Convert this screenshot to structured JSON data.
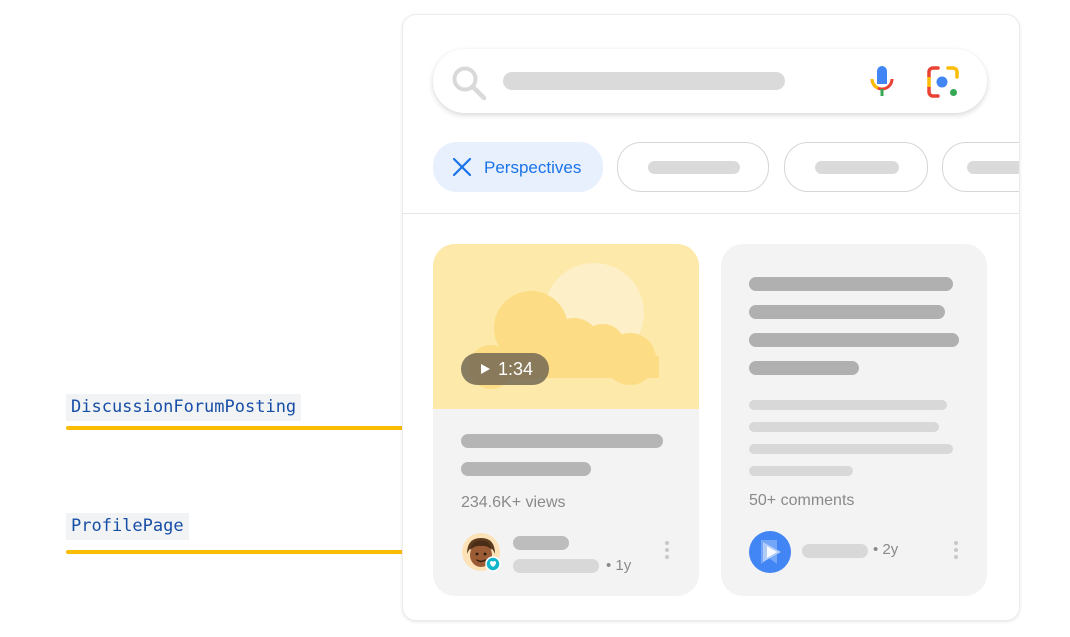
{
  "search": {
    "icon": "search-icon",
    "mic_icon": "mic-icon",
    "lens_icon": "lens-icon"
  },
  "filters": {
    "active_chip": {
      "label": "Perspectives",
      "icon": "close-icon"
    }
  },
  "results": {
    "video_card": {
      "duration": "1:34",
      "views": "234.6K+ views",
      "age": "• 1y",
      "icon": "play-icon"
    },
    "forum_card": {
      "comments": "50+ comments",
      "age": "• 2y"
    }
  },
  "annotations": {
    "discussion": "DiscussionForumPosting",
    "profile": "ProfilePage"
  },
  "colors": {
    "chip_active_bg": "#e8f0fe",
    "chip_active_text": "#1a73e8",
    "pointer_line": "#fbbc04",
    "label_text": "#174ea6",
    "thumbnail_bg": "#fde9a9",
    "placeholder_gray": "#dadada"
  }
}
